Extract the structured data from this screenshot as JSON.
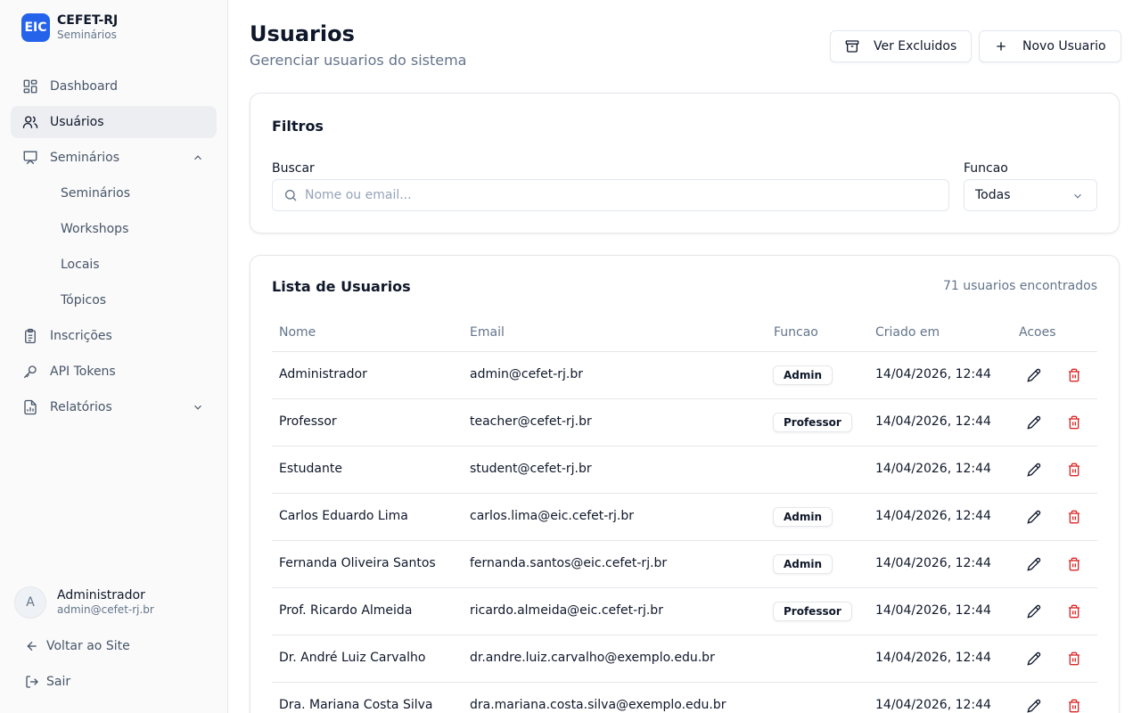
{
  "sidebar": {
    "brand": {
      "logo": "EIC",
      "title": "CEFET-RJ",
      "subtitle": "Seminários"
    },
    "nav": [
      {
        "label": "Dashboard",
        "icon": "dashboard-icon"
      },
      {
        "label": "Usuários",
        "icon": "users-icon",
        "active": true
      },
      {
        "label": "Seminários",
        "icon": "presentation-icon",
        "expanded": true
      },
      {
        "label": "Inscrições",
        "icon": "clipboard-icon"
      },
      {
        "label": "API Tokens",
        "icon": "key-icon"
      },
      {
        "label": "Relatórios",
        "icon": "report-icon",
        "expanded": false
      }
    ],
    "subnav": [
      "Seminários",
      "Workshops",
      "Locais",
      "Tópicos"
    ],
    "user": {
      "initial": "A",
      "name": "Administrador",
      "email": "admin@cefet-rj.br"
    },
    "back_label": "Voltar ao Site",
    "logout_label": "Sair"
  },
  "header": {
    "title": "Usuarios",
    "subtitle": "Gerenciar usuarios do sistema",
    "btn_deleted": "Ver Excluidos",
    "btn_new": "Novo Usuario"
  },
  "filters": {
    "title": "Filtros",
    "search_label": "Buscar",
    "search_placeholder": "Nome ou email...",
    "search_value": "",
    "role_label": "Funcao",
    "role_value": "Todas"
  },
  "list": {
    "title": "Lista de Usuarios",
    "count": "71 usuarios encontrados",
    "columns": [
      "Nome",
      "Email",
      "Funcao",
      "Criado em",
      "Acoes"
    ],
    "rows": [
      {
        "name": "Administrador",
        "email": "admin@cefet-rj.br",
        "role": "Admin",
        "created": "14/04/2026, 12:44"
      },
      {
        "name": "Professor",
        "email": "teacher@cefet-rj.br",
        "role": "Professor",
        "created": "14/04/2026, 12:44"
      },
      {
        "name": "Estudante",
        "email": "student@cefet-rj.br",
        "role": "",
        "created": "14/04/2026, 12:44"
      },
      {
        "name": "Carlos Eduardo Lima",
        "email": "carlos.lima@eic.cefet-rj.br",
        "role": "Admin",
        "created": "14/04/2026, 12:44"
      },
      {
        "name": "Fernanda Oliveira Santos",
        "email": "fernanda.santos@eic.cefet-rj.br",
        "role": "Admin",
        "created": "14/04/2026, 12:44"
      },
      {
        "name": "Prof. Ricardo Almeida",
        "email": "ricardo.almeida@eic.cefet-rj.br",
        "role": "Professor",
        "created": "14/04/2026, 12:44"
      },
      {
        "name": "Dr. André Luiz Carvalho",
        "email": "dr.andre.luiz.carvalho@exemplo.edu.br",
        "role": "",
        "created": "14/04/2026, 12:44"
      },
      {
        "name": "Dra. Mariana Costa Silva",
        "email": "dra.mariana.costa.silva@exemplo.edu.br",
        "role": "",
        "created": "14/04/2026, 12:44"
      }
    ]
  },
  "colors": {
    "brand": "#2563eb",
    "danger": "#dc2626",
    "muted": "#64748b",
    "active_bg": "#eceef2"
  }
}
